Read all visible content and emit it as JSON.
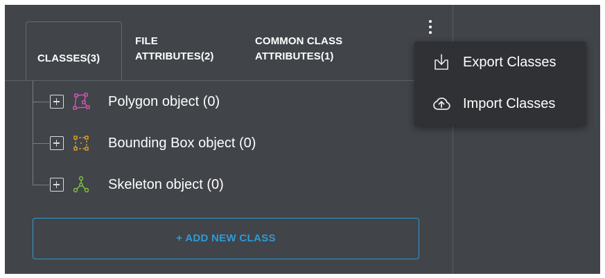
{
  "tabs": [
    {
      "line1": "CLASSES(3)",
      "line2": ""
    },
    {
      "line1": "FILE",
      "line2": "ATTRIBUTES(2)"
    },
    {
      "line1": "COMMON CLASS",
      "line2": "ATTRIBUTES(1)"
    }
  ],
  "active_tab": "CLASSES(3)",
  "classes": [
    {
      "label": "Polygon object (0)",
      "icon": "polygon-icon",
      "color": "#d455b8"
    },
    {
      "label": "Bounding Box object (0)",
      "icon": "bounding-box-icon",
      "color": "#e5a020"
    },
    {
      "label": "Skeleton object (0)",
      "icon": "skeleton-icon",
      "color": "#7cc93a"
    }
  ],
  "add_button": "+ ADD NEW CLASS",
  "menu": {
    "items": [
      {
        "label": "Export Classes",
        "icon": "export-download-icon"
      },
      {
        "label": "Import Classes",
        "icon": "cloud-upload-icon"
      }
    ]
  },
  "colors": {
    "panel_bg": "#414449",
    "menu_bg": "#2f3134",
    "accent": "#2e9bd6"
  }
}
